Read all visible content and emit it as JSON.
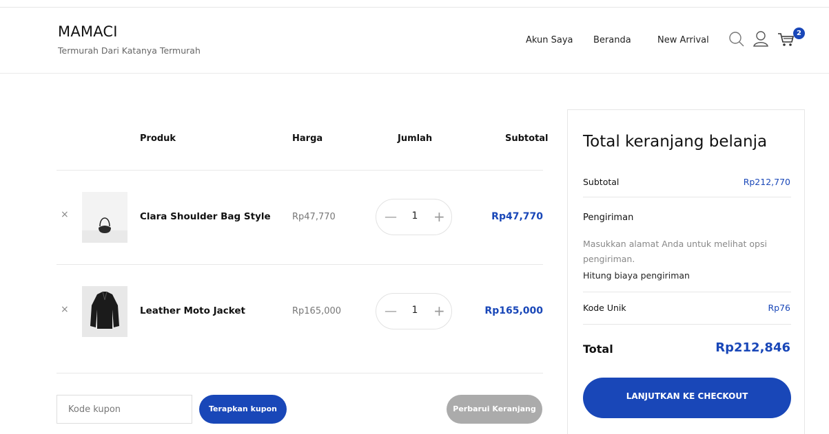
{
  "header": {
    "brand": "MAMACI",
    "tagline": "Termurah Dari Katanya Termurah",
    "nav": [
      "Akun Saya",
      "Beranda",
      "New Arrival"
    ],
    "cart_count": "2",
    "icons": [
      "search-icon",
      "user-icon",
      "cart-icon"
    ]
  },
  "cart": {
    "columns": {
      "product": "Produk",
      "price": "Harga",
      "quantity": "Jumlah",
      "subtotal": "Subtotal"
    },
    "items": [
      {
        "remove": "×",
        "name": "Clara Shoulder Bag Style",
        "price": "Rp47,770",
        "qty": "1",
        "subtotal": "Rp47,770",
        "image": "shoulder-bag"
      },
      {
        "remove": "×",
        "name": "Leather Moto Jacket",
        "price": "Rp165,000",
        "qty": "1",
        "subtotal": "Rp165,000",
        "image": "leather-jacket"
      }
    ],
    "coupon_placeholder": "Kode kupon",
    "apply_coupon": "Terapkan kupon",
    "update_cart": "Perbarui Keranjang"
  },
  "totals": {
    "title": "Total keranjang belanja",
    "subtotal_label": "Subtotal",
    "subtotal_value": "Rp212,770",
    "shipping_label": "Pengiriman",
    "shipping_note": "Masukkan alamat Anda untuk melihat opsi pengiriman.",
    "shipping_calc": "Hitung biaya pengiriman",
    "unique_code_label": "Kode Unik",
    "unique_code_value": "Rp76",
    "total_label": "Total",
    "total_value": "Rp212,846",
    "checkout": "LANJUTKAN KE CHECKOUT"
  },
  "colors": {
    "accent": "#1947b8",
    "muted_button": "#ababab"
  }
}
